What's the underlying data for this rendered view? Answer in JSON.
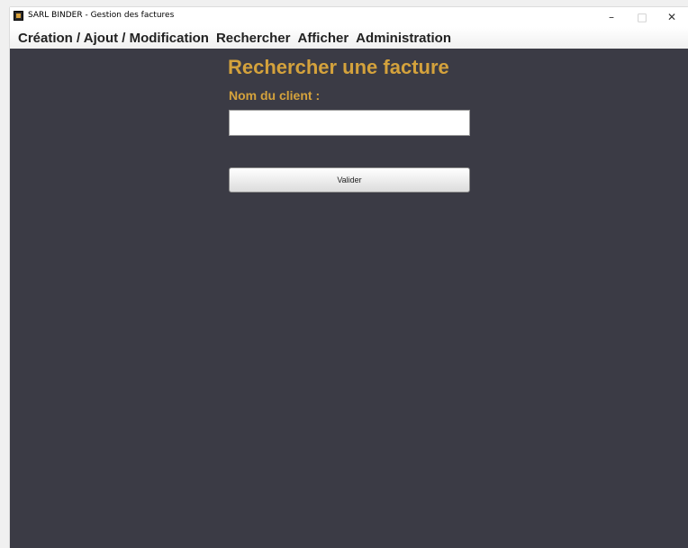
{
  "window": {
    "title": "SARL BINDER - Gestion des factures",
    "controls": {
      "minimize": "–",
      "maximize": "□",
      "close": "✕"
    }
  },
  "menu": {
    "items": [
      {
        "label": "Création / Ajout / Modification"
      },
      {
        "label": "Rechercher"
      },
      {
        "label": "Afficher"
      },
      {
        "label": "Administration"
      }
    ]
  },
  "form": {
    "title": "Rechercher une facture",
    "client_label": "Nom du client :",
    "client_value": "",
    "submit_label": "Valider"
  },
  "colors": {
    "content_bg": "#3b3b45",
    "accent": "#d4a23c"
  }
}
